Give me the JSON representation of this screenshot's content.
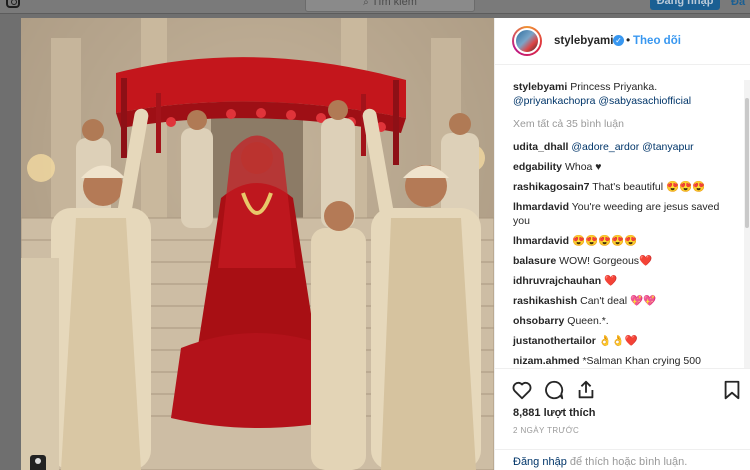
{
  "header": {
    "search_placeholder": "Tìm kiếm",
    "login_button": "Đăng nhập",
    "signup_link": "Đă"
  },
  "post": {
    "username": "stylebyami",
    "follow_label": "Theo dõi",
    "caption_user": "stylebyami",
    "caption_text": "Princess Priyanka.",
    "caption_mentions": "@priyankachopra @sabyasachiofficial",
    "view_all": "Xem tất cả 35 bình luận",
    "likes": "8,881 lượt thích",
    "time_ago": "2 NGÀY TRƯỚC",
    "login_link": "Đăng nhập",
    "login_text": "để thích hoặc bình luận."
  },
  "comments": [
    {
      "user": "udita_dhall",
      "text": "@adore_ardor @tanyapur"
    },
    {
      "user": "edgability",
      "text": "Whoa ♥"
    },
    {
      "user": "rashikagosain7",
      "text": "That's beautiful 😍😍😍"
    },
    {
      "user": "lhmardavid",
      "text": "You're weeding are jesus saved you"
    },
    {
      "user": "lhmardavid",
      "text": "😍😍😍😍😍"
    },
    {
      "user": "balasure",
      "text": "WOW! Gorgeous❤️"
    },
    {
      "user": "idhruvrajchauhan",
      "text": "❤️"
    },
    {
      "user": "rashikashish",
      "text": "Can't deal 💖💖"
    },
    {
      "user": "ohsobarry",
      "text": "Queen.*."
    },
    {
      "user": "justanothertailor",
      "text": "👌👌❤️"
    },
    {
      "user": "nizam.ahmed",
      "text": "*Salman Khan crying 500"
    }
  ],
  "icons": [
    "instagram-logo-icon",
    "search-icon",
    "verified-icon",
    "heart-icon",
    "comment-icon",
    "share-icon",
    "bookmark-icon",
    "user-tag-icon"
  ]
}
